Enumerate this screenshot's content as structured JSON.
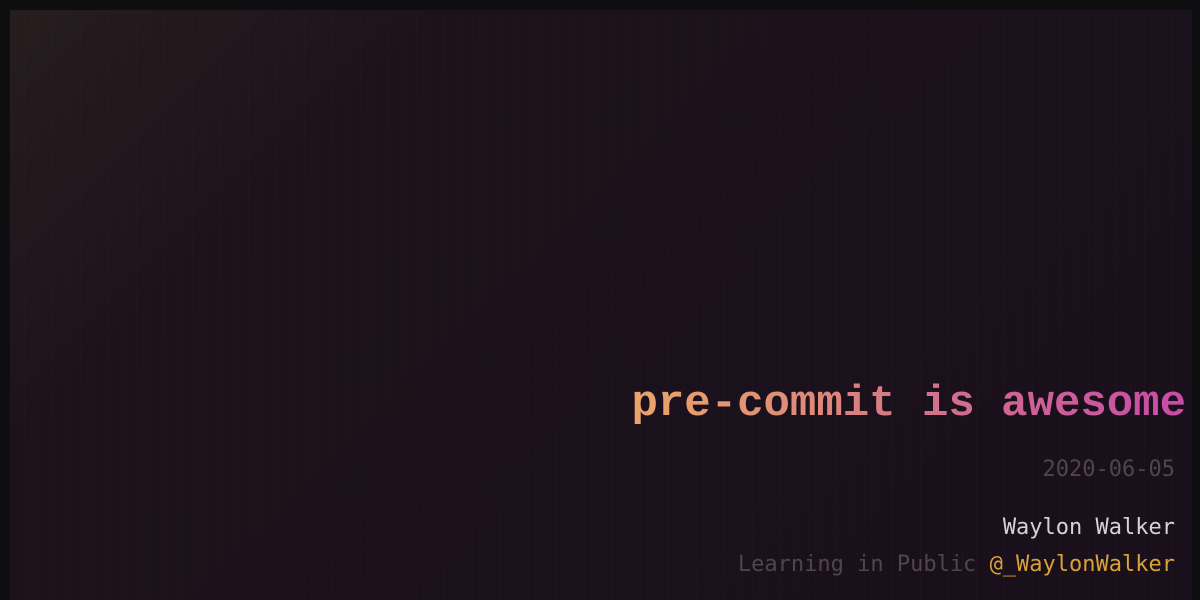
{
  "post": {
    "title": "pre-commit is awesome",
    "date": "2020-06-05",
    "author": "Waylon Walker",
    "tagline": "Learning in Public",
    "handle": "@_WaylonWalker"
  },
  "colors": {
    "background": "#1b111c",
    "title_gradient_start": "#e9a56a",
    "title_gradient_end": "#c94aa9",
    "date": "#4f4550",
    "author": "#d6d2d6",
    "handle": "#d7a238"
  }
}
